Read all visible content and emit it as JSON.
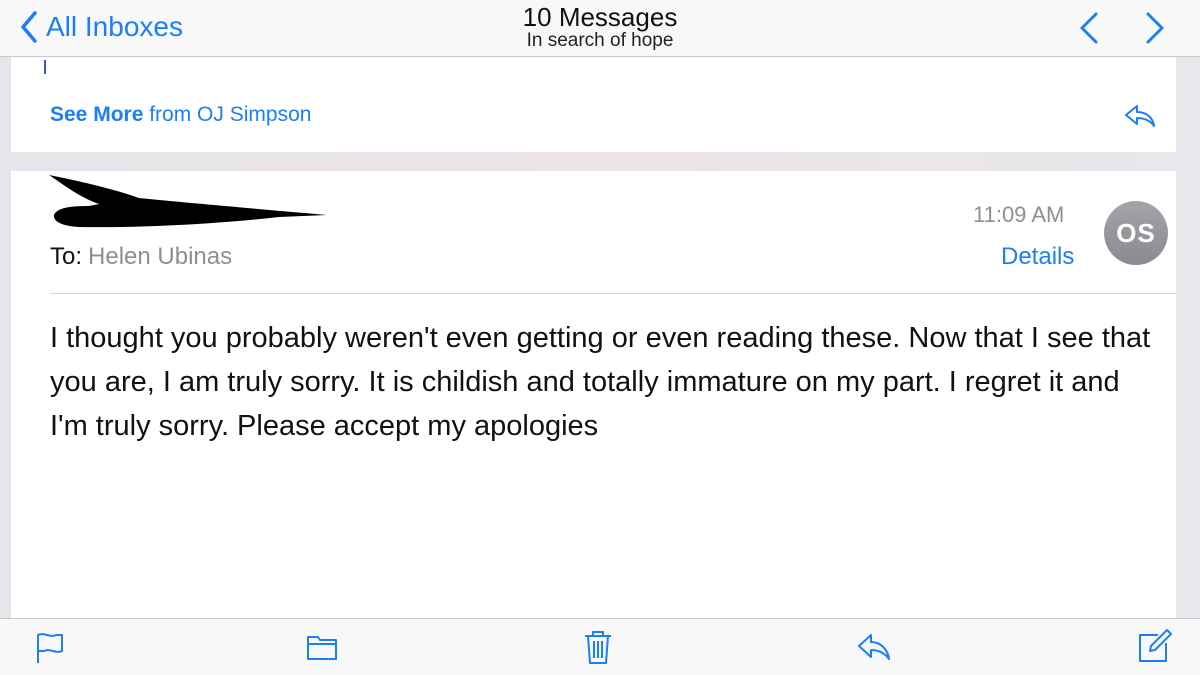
{
  "nav": {
    "back_label": "All Inboxes",
    "title": "10 Messages",
    "subtitle": "In search of hope",
    "prev_icon": "chevron-up-icon",
    "next_icon": "chevron-down-icon"
  },
  "previous_message": {
    "see_more_label": "See More",
    "from_text": "from OJ Simpson",
    "reply_icon": "reply-icon"
  },
  "message": {
    "to_label": "To:",
    "to_name": "Helen Ubinas",
    "time": "11:09 AM",
    "details_label": "Details",
    "avatar_initials": "OS",
    "body": "I thought you probably weren't even getting or even reading these. Now that I see that you are, I am truly sorry. It is childish and totally immature on my part. I regret it and I'm truly sorry. Please accept my apologies"
  },
  "toolbar": {
    "icons": [
      "flag-icon",
      "folder-icon",
      "trash-icon",
      "reply-icon",
      "compose-icon"
    ]
  },
  "colors": {
    "accent": "#1a7ffb",
    "secondary_text": "#8e8e93",
    "avatar": "#9a9a9f"
  }
}
